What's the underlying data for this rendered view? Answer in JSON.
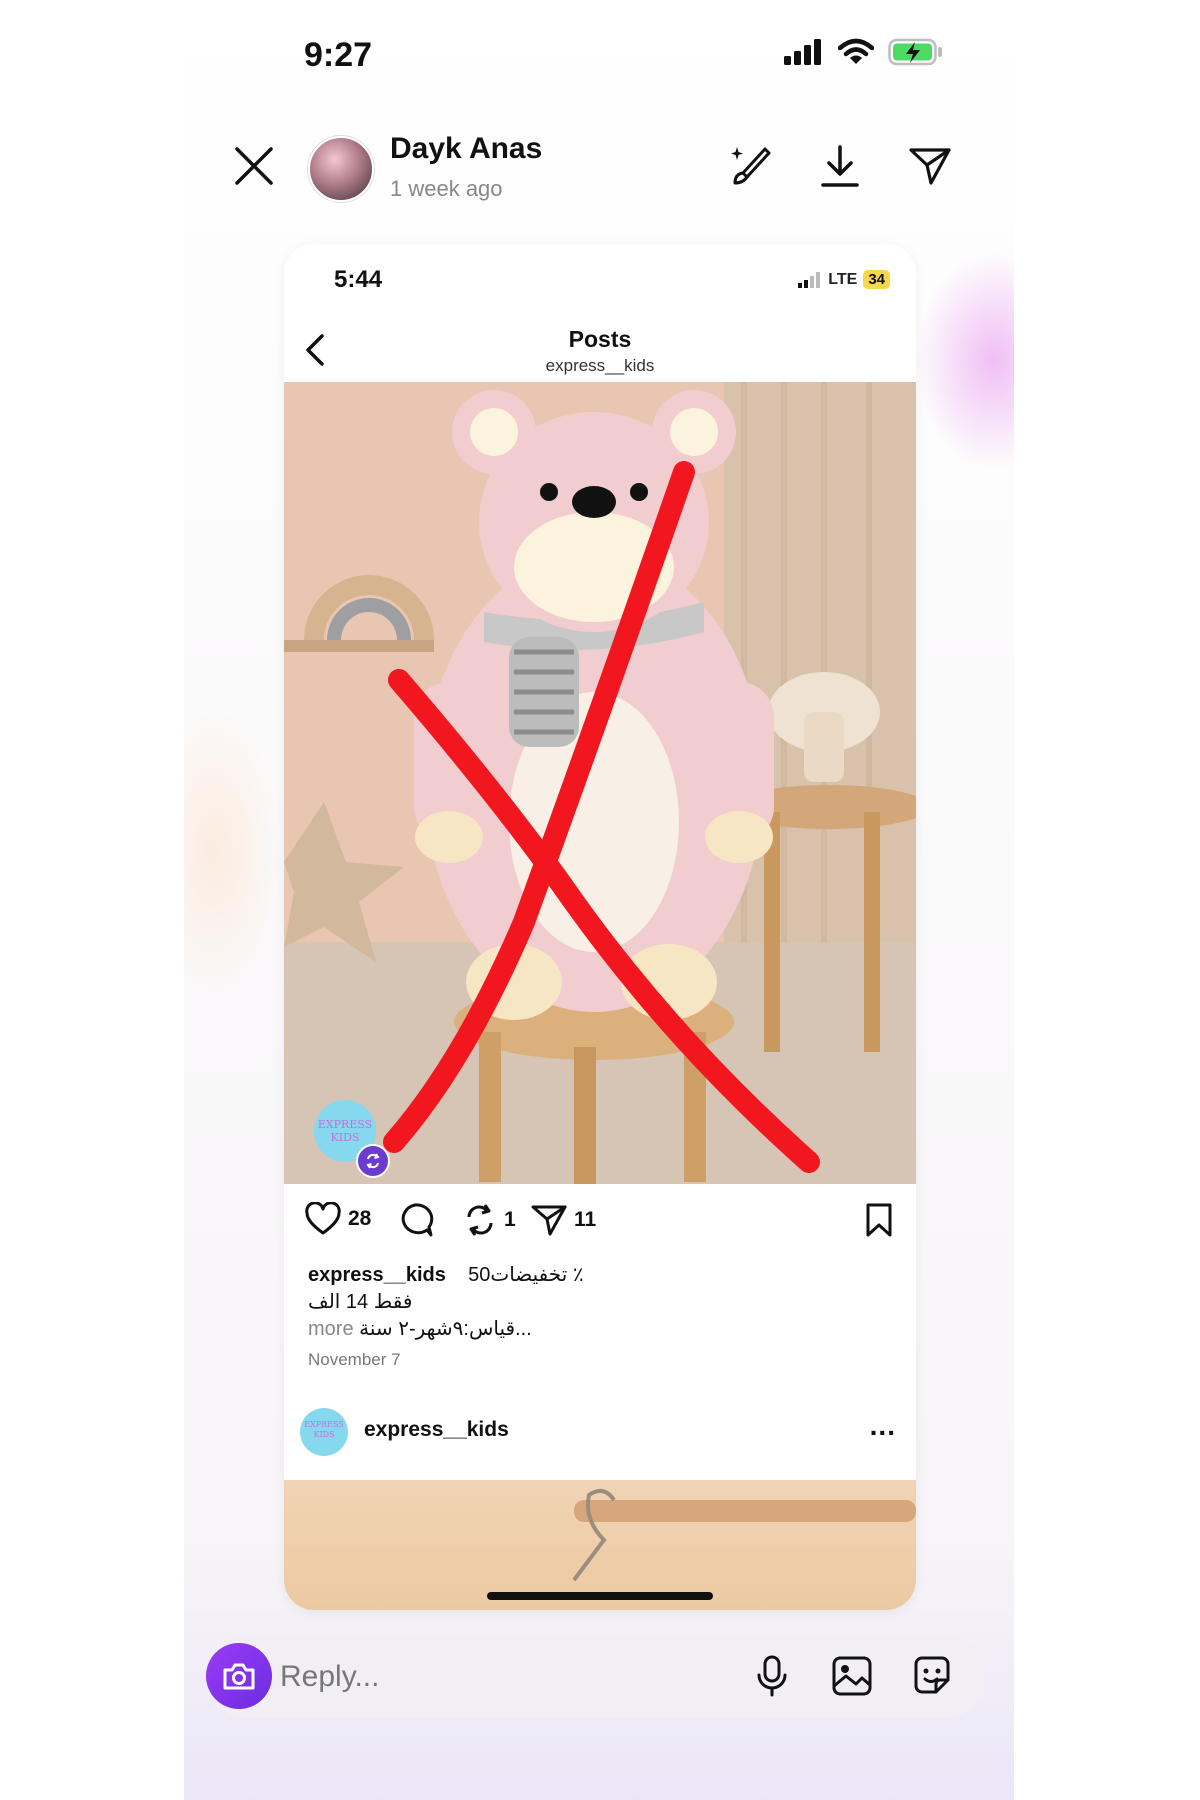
{
  "status_bar": {
    "time": "9:27"
  },
  "story_header": {
    "user_name": "Dayk Anas",
    "time_ago": "1 week ago"
  },
  "shared_post": {
    "status_bar": {
      "time": "5:44",
      "network": "LTE",
      "battery": "34"
    },
    "header": {
      "title": "Posts",
      "subtitle": "express__kids"
    },
    "repost_badge_text": "EXPRESS KIDS",
    "actions": {
      "likes": "28",
      "reposts": "1",
      "shares": "11"
    },
    "caption": {
      "username": "express__kids",
      "line1": "50تخفيضات ٪",
      "line2": "فقط 14 الف",
      "line3": "قياس:٩شهر-٢ سنة...",
      "more": "more"
    },
    "date": "November 7",
    "next_post": {
      "username": "express__kids",
      "avatar_text": "EXPRESS KIDS",
      "more": "..."
    }
  },
  "reply_bar": {
    "placeholder": "Reply..."
  },
  "colors": {
    "accent": "#7b32e8",
    "cross_mark": "#f2161e",
    "badge": "#86d8ee"
  }
}
